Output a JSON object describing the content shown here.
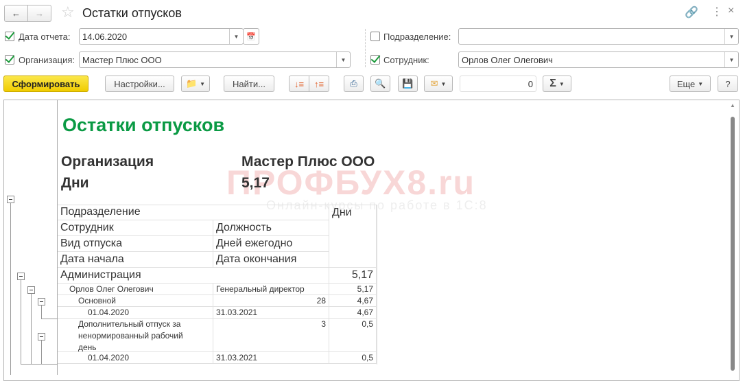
{
  "window": {
    "title": "Остатки отпусков"
  },
  "filters": {
    "report_date": {
      "label": "Дата отчета:",
      "value": "14.06.2020",
      "checked": true
    },
    "organization": {
      "label": "Организация:",
      "value": "Мастер Плюс ООО",
      "checked": true
    },
    "department": {
      "label": "Подразделение:",
      "value": "",
      "checked": false
    },
    "employee": {
      "label": "Сотрудник:",
      "value": "Орлов Олег Олегович",
      "checked": true
    }
  },
  "toolbar": {
    "generate": "Сформировать",
    "settings": "Настройки...",
    "find": "Найти...",
    "sum_value": "0",
    "more": "Еще",
    "help": "?"
  },
  "report": {
    "title": "Остатки отпусков",
    "org_label": "Организация",
    "org_value": "Мастер Плюс ООО",
    "days_label": "Дни",
    "days_value": "5,17",
    "watermark": {
      "brand": "ПРОФБУХ8.ru",
      "tagline": "Онлайн-курсы по работе в 1С:8"
    },
    "headers": {
      "department": "Подразделение",
      "days": "Дни",
      "employee": "Сотрудник",
      "position": "Должность",
      "leave_type": "Вид отпуска",
      "days_per_year": "Дней ежегодно",
      "start_date": "Дата начала",
      "end_date": "Дата окончания"
    },
    "rows": {
      "dept": {
        "name": "Администрация",
        "days": "5,17"
      },
      "emp": {
        "name": "Орлов Олег Олегович",
        "position": "Генеральный директор",
        "days": "5,17"
      },
      "leave1": {
        "name": "Основной",
        "per_year": "28",
        "days": "4,67"
      },
      "period1": {
        "start": "01.04.2020",
        "end": "31.03.2021",
        "days": "4,67"
      },
      "leave2": {
        "name": "Дополнительный отпуск за ненормированный рабочий день",
        "per_year": "3",
        "days": "0,5"
      },
      "period2": {
        "start": "01.04.2020",
        "end": "31.03.2021",
        "days": "0,5"
      }
    }
  }
}
